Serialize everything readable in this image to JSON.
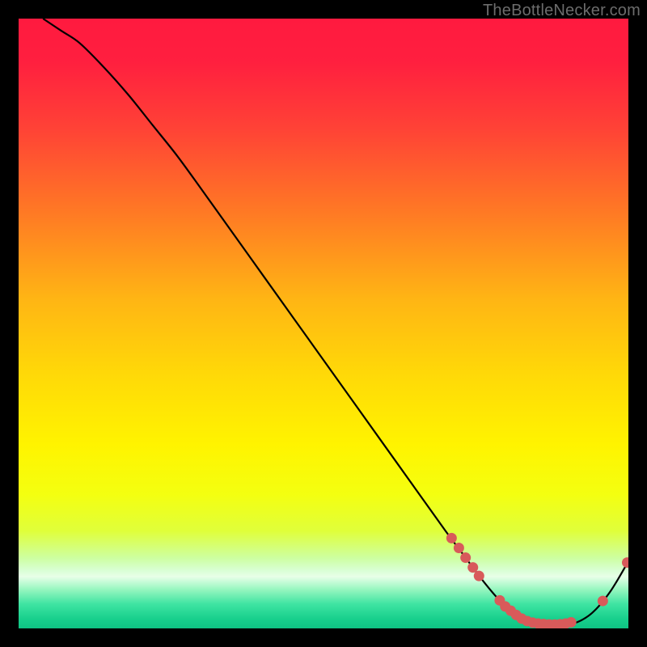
{
  "watermark": "TheBottleNecker.com",
  "chart_data": {
    "type": "line",
    "title": "",
    "xlabel": "",
    "ylabel": "",
    "xlim": [
      0,
      100
    ],
    "ylim": [
      0,
      100
    ],
    "grid": false,
    "series": [
      {
        "name": "curve",
        "x": [
          4,
          7,
          10,
          14,
          18,
          22,
          26,
          30,
          35,
          40,
          45,
          50,
          55,
          60,
          65,
          70,
          73,
          76,
          79,
          82,
          85,
          88,
          91,
          94,
          97,
          100
        ],
        "y": [
          100,
          98,
          96,
          92,
          87.5,
          82.5,
          77.5,
          72,
          65,
          58,
          51,
          44,
          37,
          30,
          23,
          16,
          12,
          8,
          4.5,
          2.2,
          1,
          0.6,
          0.8,
          2.5,
          6,
          11
        ]
      }
    ],
    "markers": [
      {
        "x": 71.0,
        "y": 14.8
      },
      {
        "x": 72.2,
        "y": 13.2
      },
      {
        "x": 73.3,
        "y": 11.6
      },
      {
        "x": 74.5,
        "y": 10.0
      },
      {
        "x": 75.5,
        "y": 8.6
      },
      {
        "x": 78.9,
        "y": 4.6
      },
      {
        "x": 79.8,
        "y": 3.6
      },
      {
        "x": 80.7,
        "y": 2.9
      },
      {
        "x": 81.6,
        "y": 2.2
      },
      {
        "x": 82.5,
        "y": 1.6
      },
      {
        "x": 83.4,
        "y": 1.2
      },
      {
        "x": 84.3,
        "y": 0.95
      },
      {
        "x": 85.2,
        "y": 0.8
      },
      {
        "x": 86.1,
        "y": 0.72
      },
      {
        "x": 87.0,
        "y": 0.65
      },
      {
        "x": 87.9,
        "y": 0.63
      },
      {
        "x": 88.8,
        "y": 0.68
      },
      {
        "x": 89.7,
        "y": 0.8
      },
      {
        "x": 90.6,
        "y": 1.0
      },
      {
        "x": 95.8,
        "y": 4.5
      },
      {
        "x": 99.8,
        "y": 10.8
      }
    ],
    "background_gradient": {
      "stops": [
        {
          "offset": 0.0,
          "color": "#ff1a3f"
        },
        {
          "offset": 0.07,
          "color": "#ff1f3f"
        },
        {
          "offset": 0.18,
          "color": "#ff4236"
        },
        {
          "offset": 0.32,
          "color": "#ff7a24"
        },
        {
          "offset": 0.46,
          "color": "#ffb514"
        },
        {
          "offset": 0.58,
          "color": "#ffd808"
        },
        {
          "offset": 0.7,
          "color": "#fff400"
        },
        {
          "offset": 0.78,
          "color": "#f4ff10"
        },
        {
          "offset": 0.84,
          "color": "#e0ff3a"
        },
        {
          "offset": 0.885,
          "color": "#cdffa2"
        },
        {
          "offset": 0.905,
          "color": "#d9ffd5"
        },
        {
          "offset": 0.915,
          "color": "#e8ffe8"
        },
        {
          "offset": 0.935,
          "color": "#9bf7c1"
        },
        {
          "offset": 0.96,
          "color": "#3fe4a2"
        },
        {
          "offset": 0.985,
          "color": "#17cf8c"
        },
        {
          "offset": 1.0,
          "color": "#0fc383"
        }
      ]
    },
    "marker_color": "#d85a5a",
    "line_color": "#000000"
  }
}
